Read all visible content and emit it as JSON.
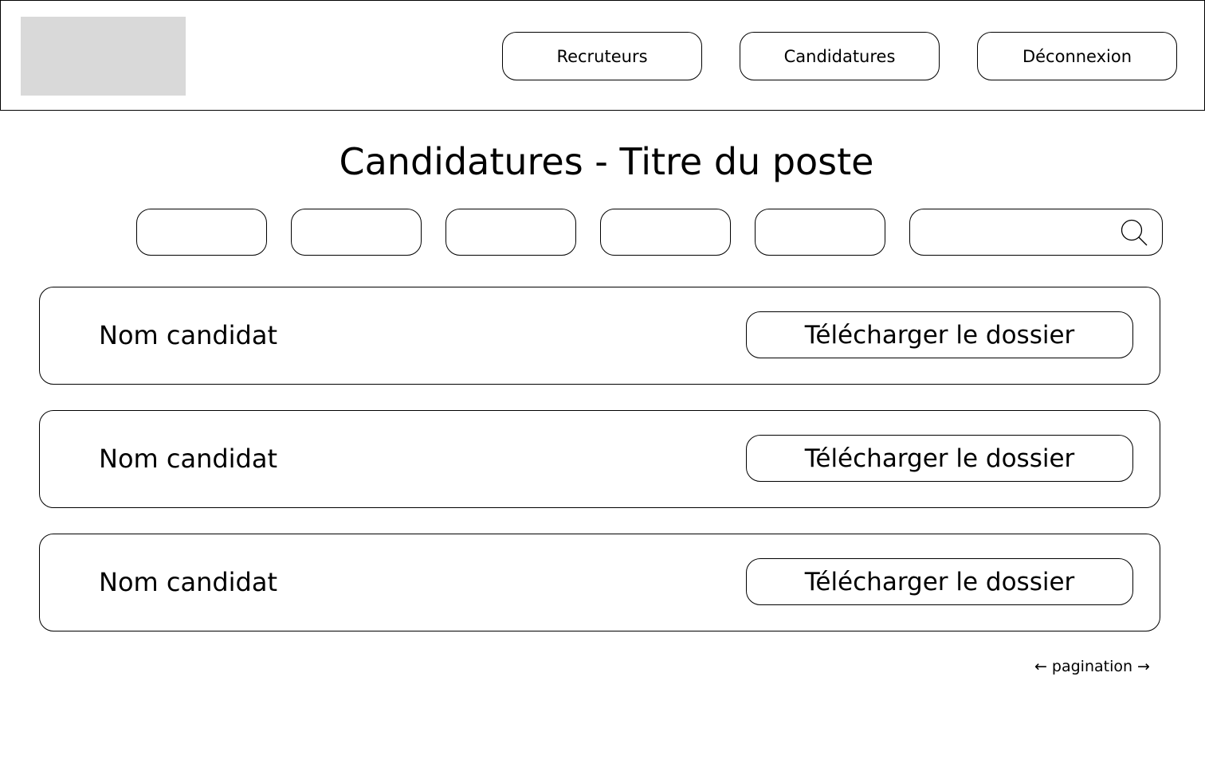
{
  "header": {
    "logo": "logo-placeholder",
    "nav": [
      {
        "label": "Recruteurs"
      },
      {
        "label": "Candidatures"
      },
      {
        "label": "Déconnexion"
      }
    ]
  },
  "page": {
    "title": "Candidatures - Titre du poste"
  },
  "filters": {
    "items": [
      "",
      "",
      "",
      "",
      ""
    ],
    "search": {
      "value": "",
      "icon": "search-icon"
    }
  },
  "candidates": [
    {
      "name": "Nom candidat",
      "action_label": "Télécharger le dossier"
    },
    {
      "name": "Nom candidat",
      "action_label": "Télécharger le dossier"
    },
    {
      "name": "Nom candidat",
      "action_label": "Télécharger le dossier"
    }
  ],
  "pagination": {
    "prev": "←",
    "label": "pagination",
    "next": "→"
  }
}
